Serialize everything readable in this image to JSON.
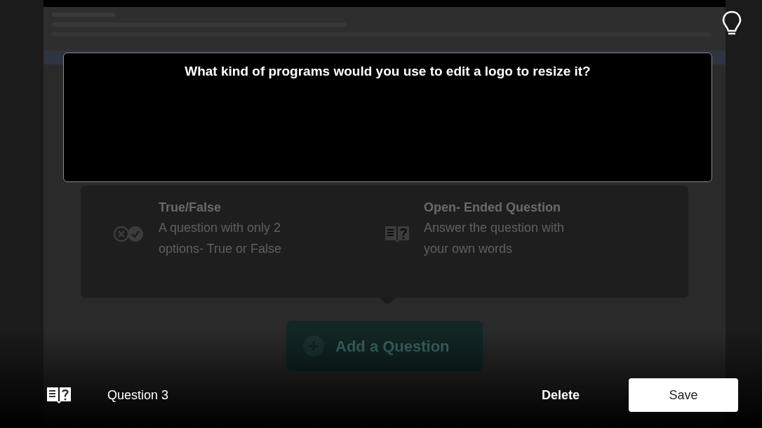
{
  "backdrop": {
    "card_items": [
      {
        "kind": "true_false",
        "title": "True/False",
        "description": "A question with only 2 options- True or False"
      },
      {
        "kind": "open_ended",
        "title": "Open- Ended Question",
        "description": "Answer the question with your own words"
      }
    ],
    "add_button": "Add a Question"
  },
  "question": {
    "text": "What kind of programs would you use to edit a logo to resize it?"
  },
  "footer": {
    "label": "Question 3",
    "delete": "Delete",
    "save": "Save"
  }
}
